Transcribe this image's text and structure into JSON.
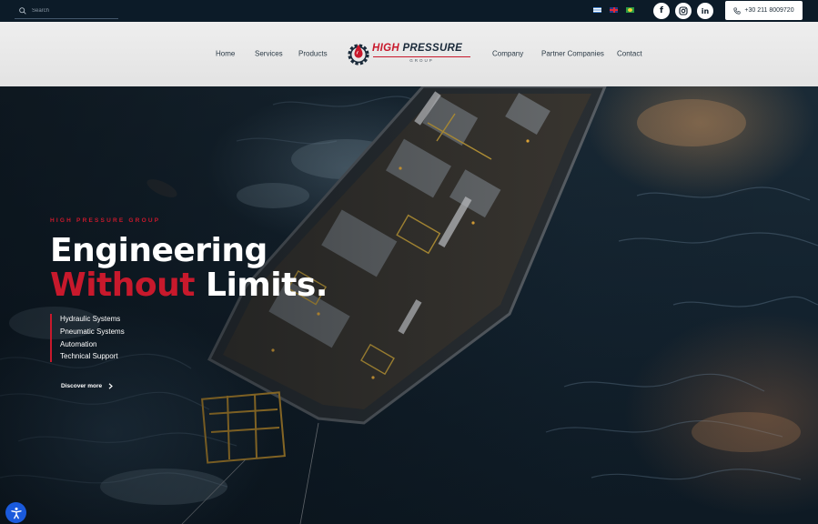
{
  "topbar": {
    "search_placeholder": "Search",
    "languages": [
      "greek-flag-icon",
      "uk-flag-icon",
      "brazil-flag-icon"
    ],
    "social": [
      {
        "name": "facebook-icon",
        "glyph": "f"
      },
      {
        "name": "instagram-icon",
        "glyph": "◎"
      },
      {
        "name": "linkedin-icon",
        "glyph": "in"
      }
    ],
    "phone": "+30 211 8009720"
  },
  "nav": {
    "items": [
      "Home",
      "Services",
      "Products",
      "Company",
      "Partner Companies",
      "Contact"
    ]
  },
  "logo": {
    "word1": "HIGH",
    "word2": "PRESSURE",
    "sub": "GROUP"
  },
  "hero": {
    "eyebrow": "HIGH PRESSURE GROUP",
    "headline_line1": "Engineering",
    "headline_red": "Without",
    "headline_rest": " Limits.",
    "services": [
      "Hydraulic Systems",
      "Pneumatic Systems",
      "Automation",
      "Technical Support"
    ],
    "cta": "Discover more"
  },
  "colors": {
    "brand_red": "#c8192c",
    "topbar_bg": "#0c1b28",
    "header_bg": "#e8e8e8",
    "accessibility_blue": "#1a5adc"
  }
}
